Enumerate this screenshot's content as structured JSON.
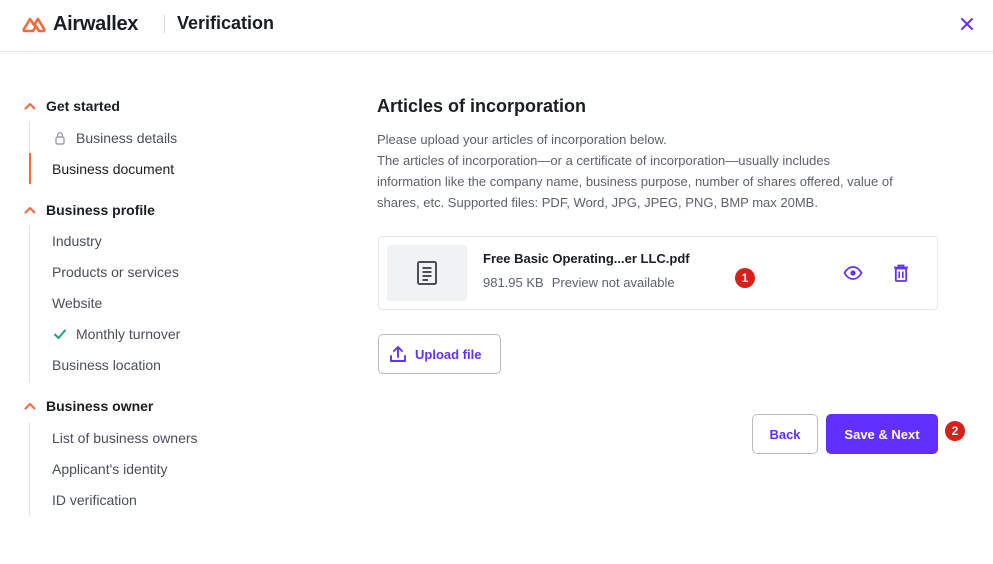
{
  "header": {
    "brand": "Airwallex",
    "title": "Verification",
    "logo_icon": "airwallex-logo-icon",
    "close_icon": "close-icon",
    "brand_color": "#f26a3b",
    "accent_color": "#612fff"
  },
  "sidebar": {
    "sections": [
      {
        "title": "Get started",
        "items": [
          {
            "label": "Business details",
            "icon": "lock-icon"
          },
          {
            "label": "Business document",
            "active": true
          }
        ]
      },
      {
        "title": "Business profile",
        "items": [
          {
            "label": "Industry"
          },
          {
            "label": "Products or services"
          },
          {
            "label": "Website"
          },
          {
            "label": "Monthly turnover",
            "icon": "check-icon",
            "completed": true
          },
          {
            "label": "Business location"
          }
        ]
      },
      {
        "title": "Business owner",
        "items": [
          {
            "label": "List of business owners"
          },
          {
            "label": "Applicant's identity"
          },
          {
            "label": "ID verification"
          }
        ]
      }
    ]
  },
  "main": {
    "title": "Articles of incorporation",
    "description_lines": [
      "Please upload your articles of incorporation below.",
      "The articles of incorporation—or a certificate of incorporation—usually includes",
      "information like the company name, business purpose, number of shares offered, value of",
      "shares, etc. Supported files: PDF, Word, JPG, JPEG, PNG, BMP max 20MB."
    ],
    "file": {
      "name": "Free Basic Operating...er LLC.pdf",
      "size": "981.95 KB",
      "preview_status": "Preview not available",
      "thumb_icon": "document-icon",
      "view_icon": "eye-icon",
      "delete_icon": "trash-icon"
    },
    "upload_label": "Upload file",
    "upload_icon": "upload-icon"
  },
  "footer": {
    "back_label": "Back",
    "next_label": "Save & Next"
  },
  "annotations": [
    "1",
    "2"
  ]
}
